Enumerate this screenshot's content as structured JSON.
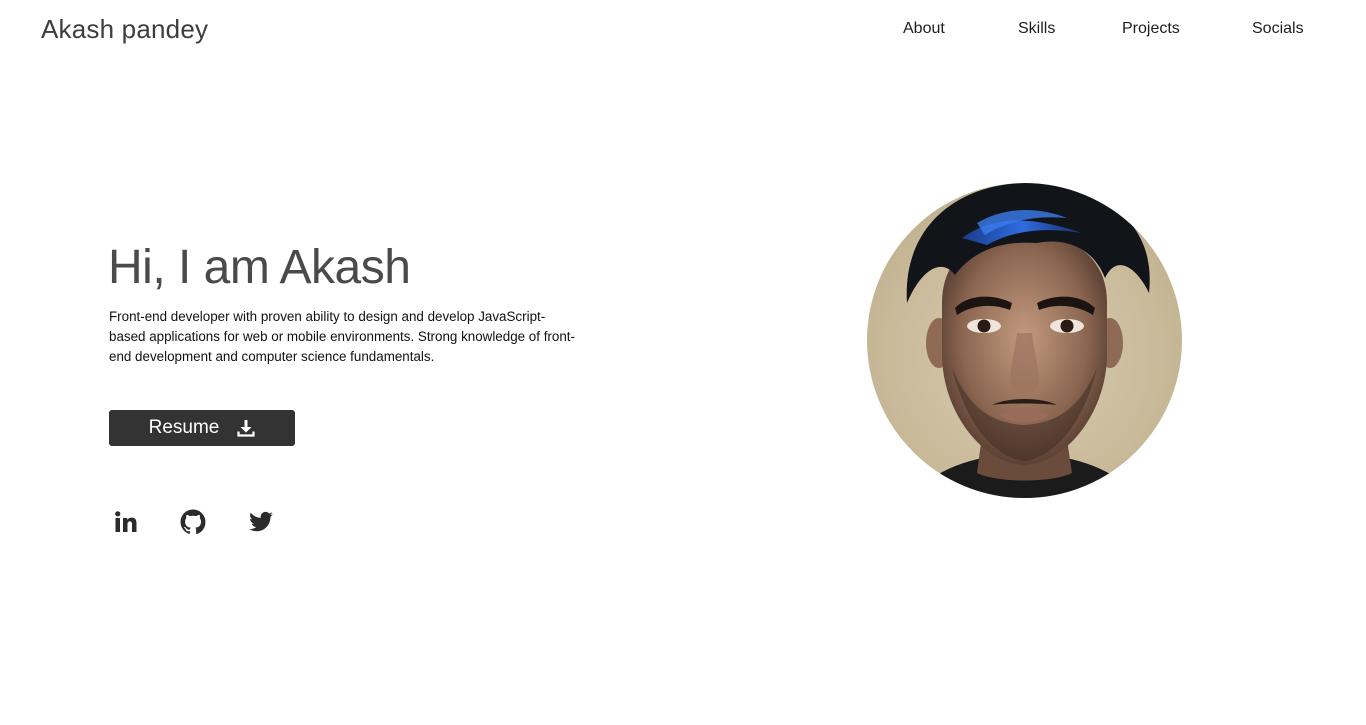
{
  "header": {
    "logo": "Akash pandey",
    "nav": [
      "About",
      "Skills",
      "Projects",
      "Socials"
    ]
  },
  "hero": {
    "title": "Hi, I am Akash",
    "description": "Front-end developer with proven ability to design and develop JavaScript-based applications for web or mobile environments. Strong knowledge of front-end development and computer science fundamentals.",
    "resume_label": "Resume",
    "resume_icon": "download-icon"
  },
  "socials": [
    {
      "name": "linkedin-icon"
    },
    {
      "name": "github-icon"
    },
    {
      "name": "twitter-icon"
    }
  ],
  "colors": {
    "button_bg": "#333333",
    "title": "#4a4a4a",
    "text": "#111111",
    "icon": "#2b2b2b"
  }
}
